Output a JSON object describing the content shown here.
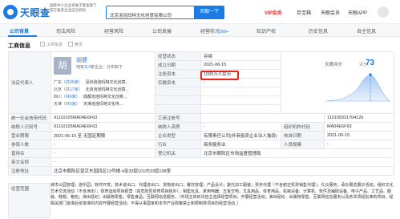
{
  "brand": {
    "name": "天眼查",
    "gov_tag_line1": "国家中小企业发展子基金旗下",
    "gov_tag_line2": "官方备案企业征信机构"
  },
  "search": {
    "value": "北京泡泡玛特文化创意有限公司",
    "button": "天眼一下"
  },
  "nav": {
    "vip": "VIP会员",
    "enterprise": "百宝箱",
    "user": "天眼会员",
    "app": "天眼APP"
  },
  "tabs": [
    {
      "label": "公司背景"
    },
    {
      "label": "司法风险"
    },
    {
      "label": "经营风险"
    },
    {
      "label": "公司发展"
    },
    {
      "label": "经营状况",
      "count": "999+"
    },
    {
      "label": "知识产权"
    },
    {
      "label": "历史信息"
    },
    {
      "label": "自主信息"
    }
  ],
  "section": {
    "title": "工商信息",
    "opt1": "工商信息",
    "opt2": "英文"
  },
  "legal_rep": {
    "label": "法定代表人",
    "initial": "胡",
    "name": "胡健",
    "desc_prefix": "他有",
    "desc_count": "114",
    "desc_suffix": "家企业，分布如下",
    "rows": [
      {
        "city": "广东",
        "count": "共35家",
        "company": "深圳泡泡玛特文化创意..."
      },
      {
        "city": "北京",
        "count": "共17家",
        "company": "北京泡泡玛特文化创意..."
      },
      {
        "city": "四川",
        "count": "共6家",
        "company": "成都泡泡玛特文化创意..."
      },
      {
        "city": "天津",
        "count": "共5家",
        "company": "天津泡泡玛特文化传..."
      }
    ]
  },
  "fields": {
    "status_label": "经营状态",
    "status": "存续",
    "founded_label": "成立日期",
    "founded": "2021-06-15",
    "capital_label": "注册资本",
    "capital": "1000万人民币",
    "paid_label": "实缴资本",
    "paid": "-",
    "uscc_label": "统一社会信用代码",
    "uscc": "91110105MA04E6F63",
    "taxid_label": "纳税人识别号",
    "taxid": "91110105MA04E6F63",
    "regno_label": "工商注册号",
    "regno": "110105031704126",
    "orgcode_label": "组织机构代码",
    "orgcode": "MA04E6F63",
    "term_label": "营业期限",
    "term": "2021-06-15 至 无固定期限",
    "taxpayer_label": "纳税人资质",
    "taxpayer": "-",
    "approve_label": "核准日期",
    "approve": "2021-06-15",
    "type_label": "企业类型",
    "type": "有限责任公司(外商投资企业法人独资)",
    "industry_label": "行业",
    "industry": "商务服务业",
    "staff_label": "人员规模",
    "staff": "-",
    "insured_label": "参保人数",
    "insured": "-",
    "authority_label": "登记机关",
    "authority": "北京市朝阳区市场监督管理局",
    "former_label": "曾用名",
    "former": "-",
    "en_label": "英文名称",
    "en": "-",
    "address_label": "注册地址",
    "address": "北京市朝阳区望京东园四区13号楼-4至33层101内33层108室",
    "scope_label": "经营范围",
    "scope": "城市公园管理；游乐园；软件开发；技术进出口、代理进出口、货物进出口；餐饮管理；产品设计；委托加工服装；票务代理（不含航空机票销售代理）；礼仪服务；承办展览展示活动；组织文化艺术交流活动（不含演出）；体育运动项目经营（高危险性体育项目除外）；销售玩具、家用电器、五金交电、文具用品、体育用品、机械设备、计算机、软件及辅助设备、电子产品、工艺品、服装、鞋帽、箱包；演出经纪；出版物零售；零售食品；互联网信息服务。（市场主体依法自主选择经营项目，开展经营活动；演出经纪、出版物零售、互联网信息服务以及依法须经批准的项目，经相关部门批准后依批准的内容开展经营活动；不得从事国家和本市产业政策禁止和限制类项目的经营活动。）"
  },
  "score": {
    "label": "天眼评分",
    "prefix": "评分",
    "value": "73"
  },
  "colors": {
    "accent": "#1c7ce4",
    "highlight": "#e8251c",
    "vip": "#e0302e"
  }
}
